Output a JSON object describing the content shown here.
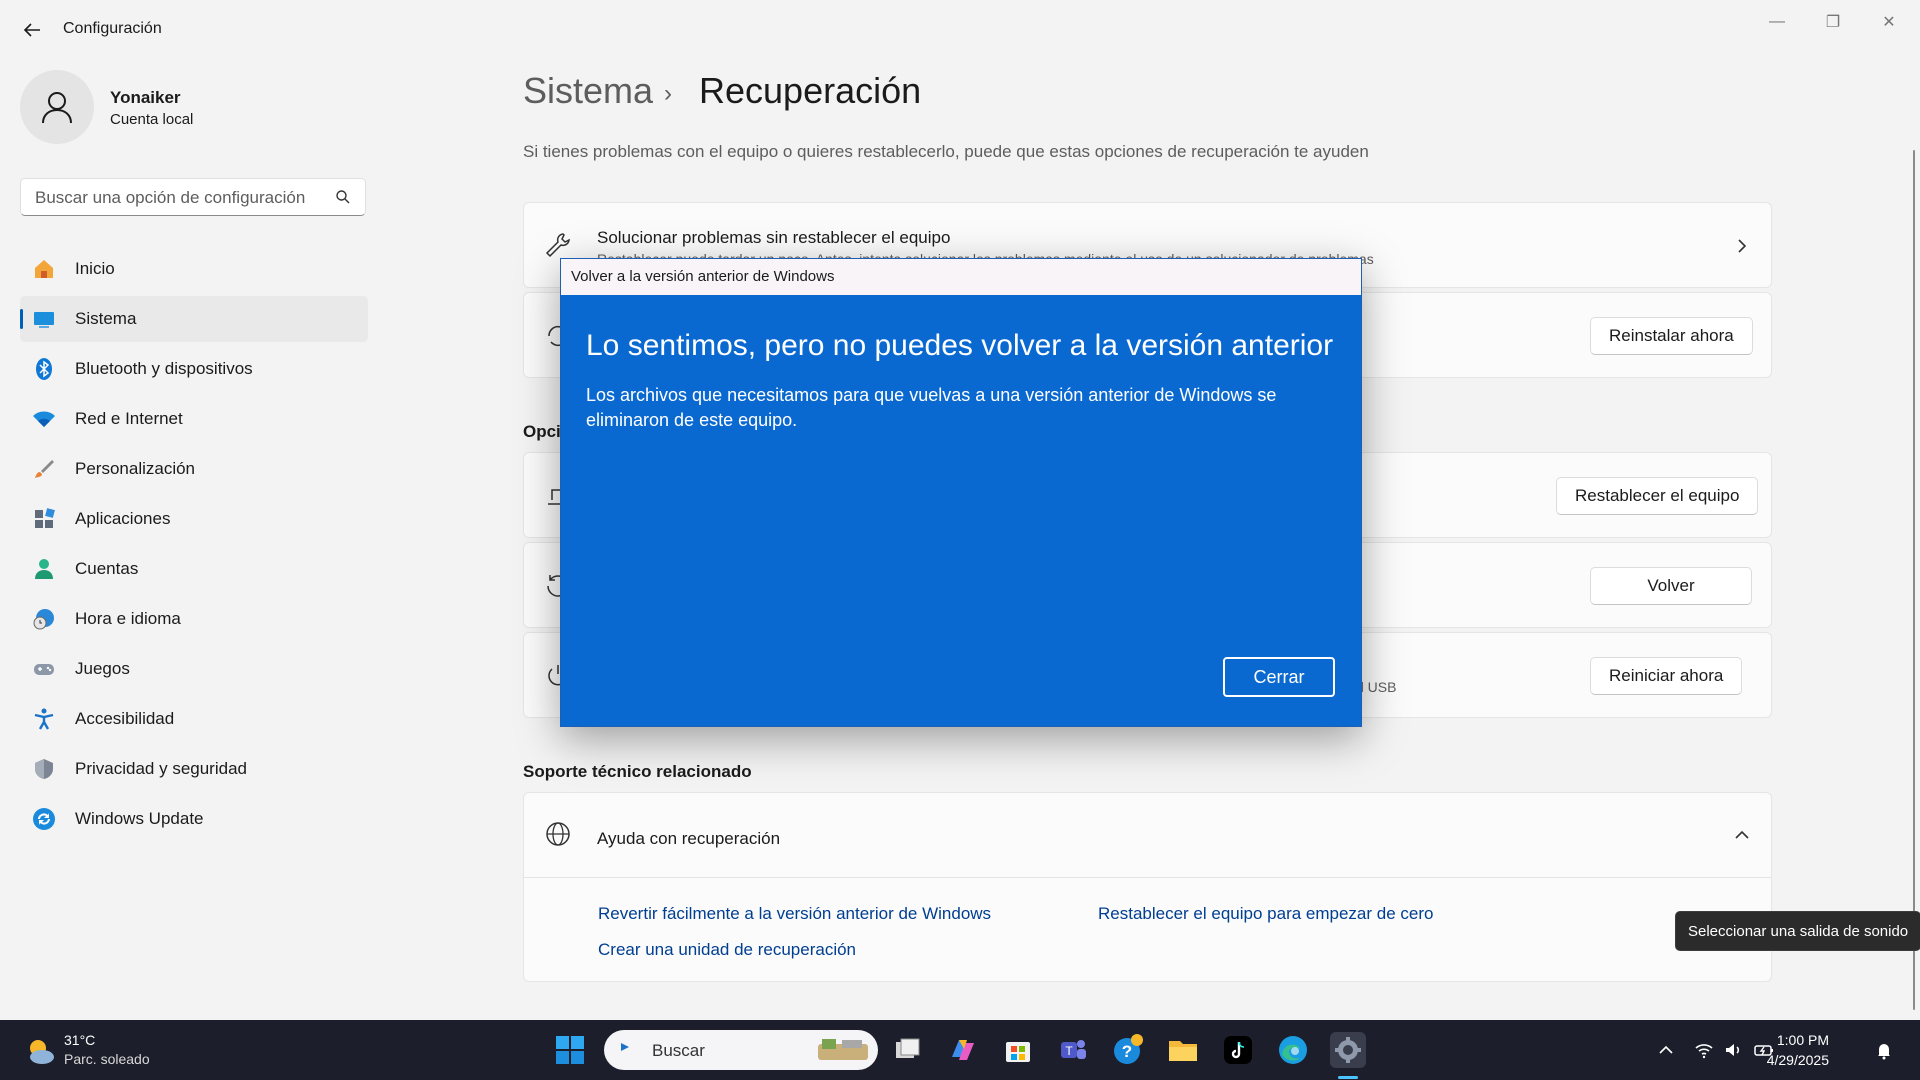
{
  "window": {
    "title": "Configuración",
    "minimize_glyph": "—",
    "restore_glyph": "❐",
    "close_glyph": "✕"
  },
  "profile": {
    "name": "Yonaiker",
    "account_type": "Cuenta local"
  },
  "search": {
    "placeholder": "Buscar una opción de configuración"
  },
  "nav": {
    "items": [
      {
        "label": "Inicio",
        "icon": "home-icon"
      },
      {
        "label": "Sistema",
        "icon": "system-icon",
        "active": true
      },
      {
        "label": "Bluetooth y dispositivos",
        "icon": "bluetooth-icon"
      },
      {
        "label": "Red e Internet",
        "icon": "wifi-icon"
      },
      {
        "label": "Personalización",
        "icon": "brush-icon"
      },
      {
        "label": "Aplicaciones",
        "icon": "apps-icon"
      },
      {
        "label": "Cuentas",
        "icon": "person-icon"
      },
      {
        "label": "Hora e idioma",
        "icon": "globe-clock-icon"
      },
      {
        "label": "Juegos",
        "icon": "gamepad-icon"
      },
      {
        "label": "Accesibilidad",
        "icon": "accessibility-icon"
      },
      {
        "label": "Privacidad y seguridad",
        "icon": "shield-icon"
      },
      {
        "label": "Windows Update",
        "icon": "windows-update-icon"
      }
    ]
  },
  "main": {
    "breadcrumb_parent": "Sistema",
    "breadcrumb_separator": "›",
    "breadcrumb_current": "Recuperación",
    "description": "Si tienes problemas con el equipo o quieres restablecerlo, puede que estas opciones de recuperación te ayuden",
    "troubleshoot_card": {
      "title": "Solucionar problemas sin restablecer el equipo",
      "subtitle": "Restablecer puede tardar un poco. Antes, intenta solucionar los problemas mediante el uso de un solucionador de problemas"
    },
    "reinstall_button": "Reinstalar ahora",
    "options_heading": "Opciones de recuperación",
    "reset_button": "Restablecer el equipo",
    "goback_button": "Volver",
    "advanced_partial_subtitle": "d USB",
    "restart_button": "Reiniciar ahora",
    "support_heading": "Soporte técnico relacionado",
    "help_card_title": "Ayuda con recuperación",
    "links": [
      "Revertir fácilmente a la versión anterior de Windows",
      "Restablecer el equipo para empezar de cero",
      "Crear una unidad de recuperación"
    ]
  },
  "dialog": {
    "title": "Volver a la versión anterior de Windows",
    "heading": "Lo sentimos, pero no puedes volver a la versión anterior",
    "message": "Los archivos que necesitamos para que vuelvas a una versión anterior de Windows se eliminaron de este equipo.",
    "close_button": "Cerrar"
  },
  "tooltip": {
    "text": "Seleccionar una salida de sonido"
  },
  "taskbar": {
    "weather_temp": "31°C",
    "weather_desc": "Parc. soleado",
    "search_placeholder": "Buscar",
    "time": "1:00 PM",
    "date": "4/29/2025"
  },
  "colors": {
    "accent": "#005fb8",
    "dialog_blue": "#0a69d1",
    "taskbar": "#1c1f2b"
  }
}
